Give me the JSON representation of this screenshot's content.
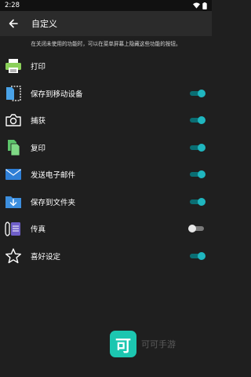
{
  "status_bar": {
    "time": "2:28"
  },
  "toolbar": {
    "title": "自定义"
  },
  "description": "在关闭未使用的功能时，可以在菜单屏幕上隐藏这些功能的按钮。",
  "items": [
    {
      "label": "打印",
      "icon": "printer-icon",
      "toggle": null
    },
    {
      "label": "保存到移动设备",
      "icon": "save-to-device-icon",
      "toggle": true
    },
    {
      "label": "捕获",
      "icon": "camera-icon",
      "toggle": true
    },
    {
      "label": "复印",
      "icon": "copy-icon",
      "toggle": true
    },
    {
      "label": "发送电子邮件",
      "icon": "email-icon",
      "toggle": true
    },
    {
      "label": "保存到文件夹",
      "icon": "folder-download-icon",
      "toggle": true
    },
    {
      "label": "传真",
      "icon": "fax-icon",
      "toggle": false
    },
    {
      "label": "喜好设定",
      "icon": "star-icon",
      "toggle": true
    }
  ],
  "watermark": {
    "logo_text": "可",
    "text": "可可手游"
  },
  "colors": {
    "accent": "#1fb6bf",
    "background": "#1f1f1f",
    "toolbar": "#2b2b2b"
  }
}
